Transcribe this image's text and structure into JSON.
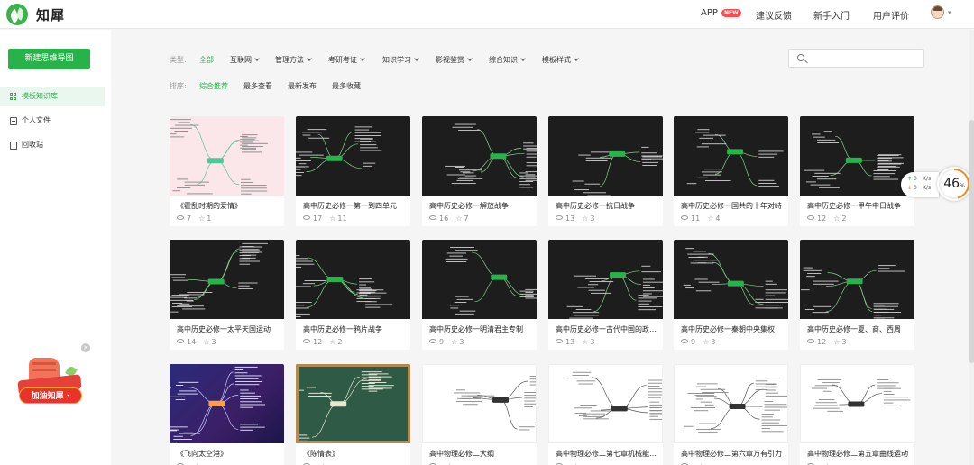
{
  "header": {
    "logo_text": "知犀",
    "nav": {
      "app": "APP",
      "new_badge": "NEW",
      "feedback": "建议反馈",
      "guide": "新手入门",
      "review": "用户评价"
    }
  },
  "sidebar": {
    "new_button": "新建思维导图",
    "items": [
      {
        "label": "模板知识库",
        "icon": "grid-icon",
        "active": true
      },
      {
        "label": "个人文件",
        "icon": "file-icon",
        "active": false
      },
      {
        "label": "回收站",
        "icon": "trash-icon",
        "active": false
      }
    ],
    "promo_button": "加油知犀"
  },
  "filters": {
    "type_label": "类型:",
    "types": [
      "全部",
      "互联网",
      "管理方法",
      "考研考证",
      "知识学习",
      "影视鉴赏",
      "综合知识",
      "模板样式"
    ],
    "sort_label": "排序:",
    "sorts": [
      "综合推荐",
      "最多查看",
      "最新发布",
      "最多收藏"
    ],
    "search_placeholder": ""
  },
  "cards": [
    {
      "title": "《霍乱时期的爱情》",
      "views": "7",
      "stars": "1",
      "style": "pink"
    },
    {
      "title": "高中历史必修一第一到四单元",
      "views": "17",
      "stars": "11",
      "style": "dark"
    },
    {
      "title": "高中历史必修一解放战争",
      "views": "16",
      "stars": "7",
      "style": "dark"
    },
    {
      "title": "高中历史必修一抗日战争",
      "views": "13",
      "stars": "3",
      "style": "dark"
    },
    {
      "title": "高中历史必修一国共的十年对峙",
      "views": "11",
      "stars": "4",
      "style": "dark"
    },
    {
      "title": "高中历史必修一甲午中日战争",
      "views": "12",
      "stars": "2",
      "style": "dark"
    },
    {
      "title": "高中历史必修一太平天国运动",
      "views": "14",
      "stars": "3",
      "style": "dark"
    },
    {
      "title": "高中历史必修一鸦片战争",
      "views": "12",
      "stars": "2",
      "style": "dark"
    },
    {
      "title": "高中历史必修一明清君主专制",
      "views": "9",
      "stars": "3",
      "style": "dark"
    },
    {
      "title": "高中历史必修一古代中国的政治制度",
      "views": "13",
      "stars": "3",
      "style": "dark"
    },
    {
      "title": "高中历史必修一秦朝中央集权",
      "views": "9",
      "stars": "3",
      "style": "dark"
    },
    {
      "title": "高中历史必修一夏、商、西周",
      "views": "12",
      "stars": "3",
      "style": "dark"
    },
    {
      "title": "《飞向太空港》",
      "views": "",
      "stars": "",
      "style": "space"
    },
    {
      "title": "《陈情表》",
      "views": "",
      "stars": "",
      "style": "board"
    },
    {
      "title": "高中物理必修二大纲",
      "views": "",
      "stars": "",
      "style": "light"
    },
    {
      "title": "高中物理必修二第七章机械能守恒定律",
      "views": "",
      "stars": "",
      "style": "light"
    },
    {
      "title": "高中物理必修二第六章万有引力",
      "views": "",
      "stars": "",
      "style": "light"
    },
    {
      "title": "高中物理必修二第五章曲线运动",
      "views": "",
      "stars": "",
      "style": "light"
    }
  ],
  "speed_widget": {
    "percent": "46",
    "percent_unit": "%",
    "up_value": "0",
    "up_unit": "K/s",
    "down_value": "0",
    "down_unit": "K/s"
  },
  "colors": {
    "brand": "#27b34a",
    "badge": "#ff4d4f",
    "ring": "#f08a24"
  }
}
